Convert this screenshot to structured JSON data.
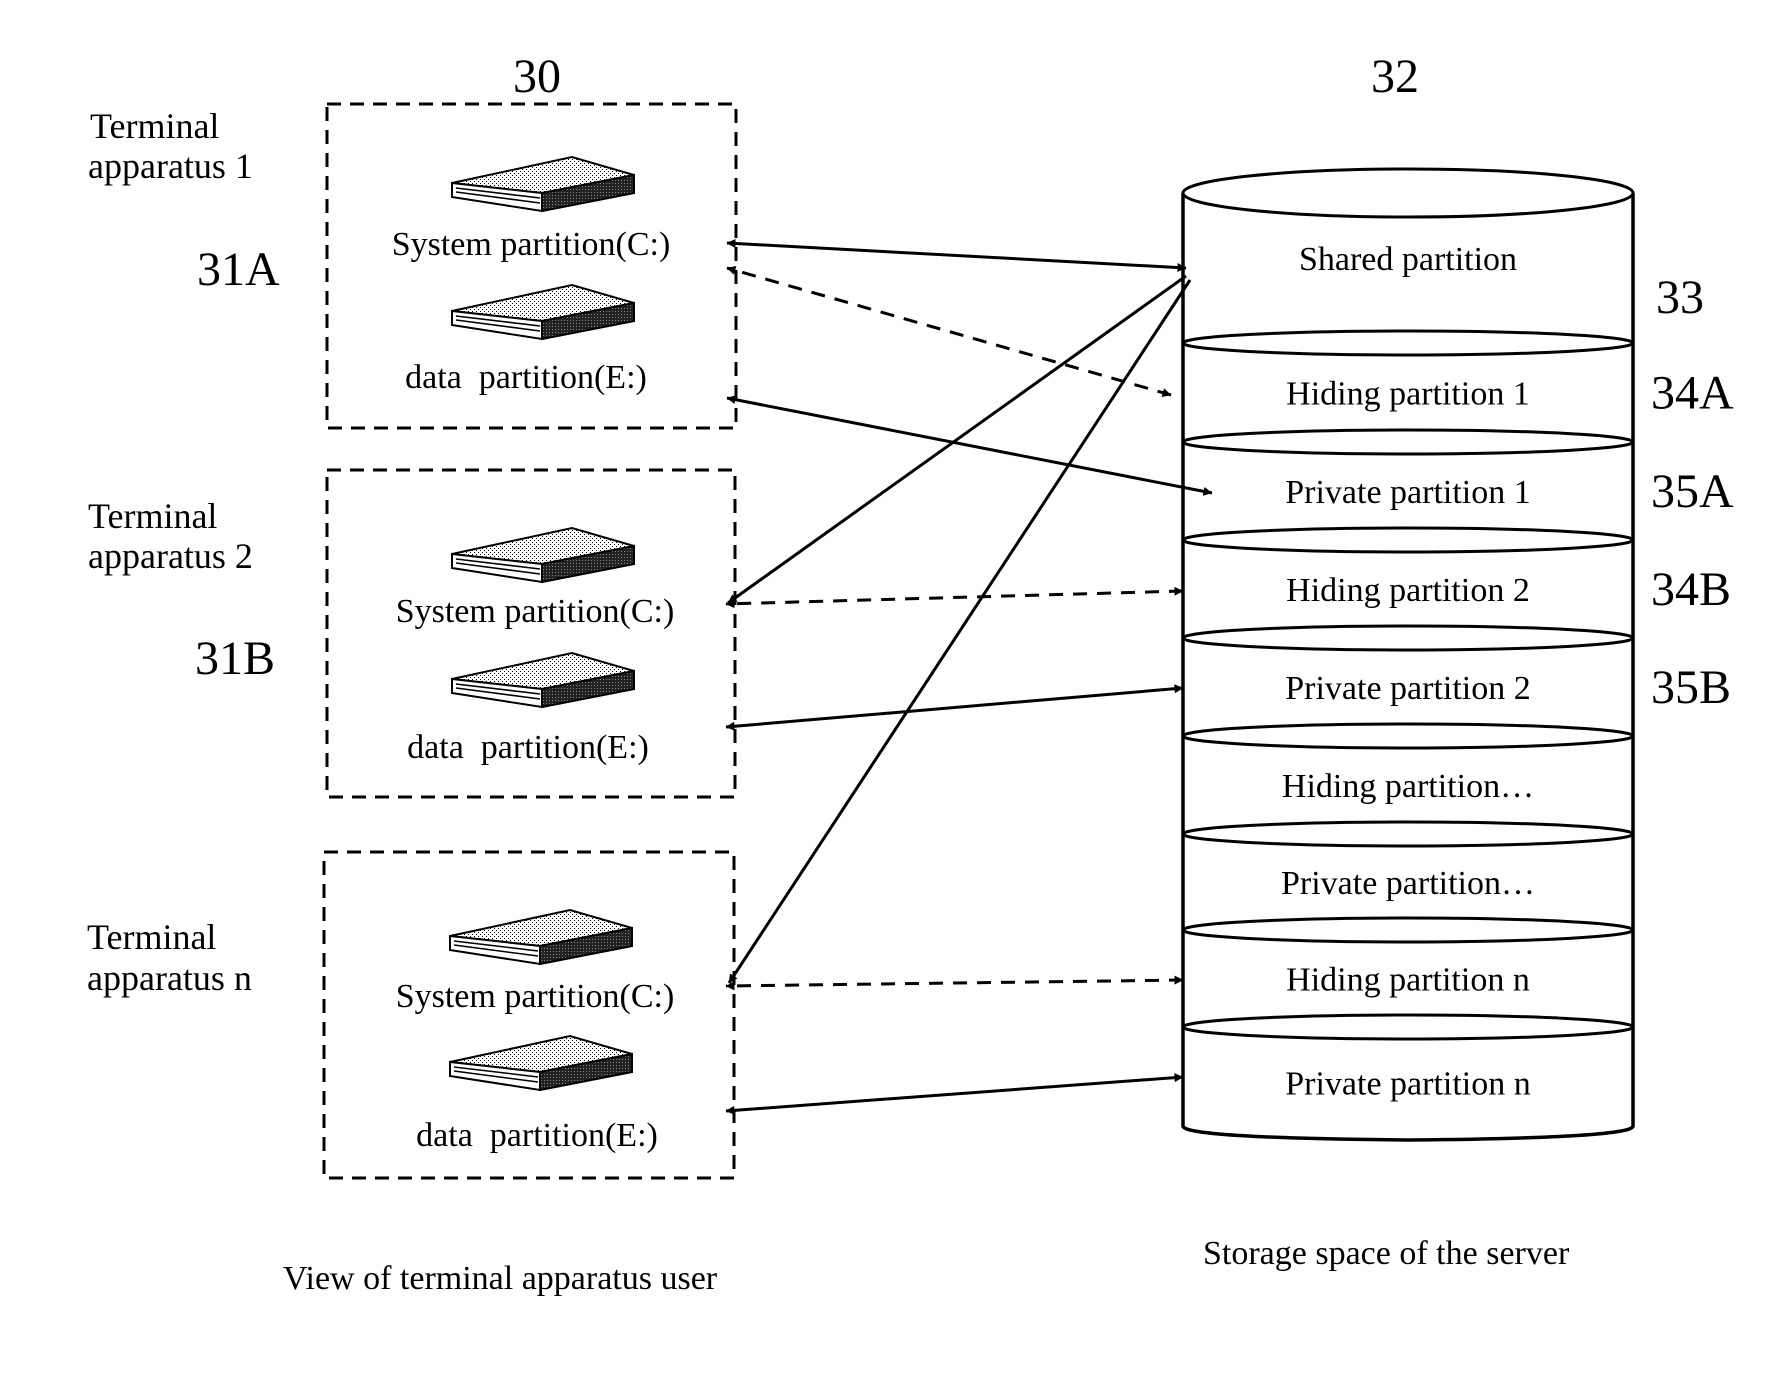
{
  "figure": {
    "ref_terminal_view": "30",
    "ref_server_storage": "32",
    "caption_left": "View of terminal apparatus user",
    "caption_right": "Storage space of the server"
  },
  "terminals": [
    {
      "name_line1": "Terminal",
      "name_line2": "apparatus 1",
      "ref": "31A",
      "system_partition": "System partition(C:)",
      "data_partition": "data  partition(E:)"
    },
    {
      "name_line1": "Terminal",
      "name_line2": "apparatus 2",
      "ref": "31B",
      "system_partition": "System partition(C:)",
      "data_partition": "data  partition(E:)"
    },
    {
      "name_line1": "Terminal",
      "name_line2": "apparatus n",
      "ref": "",
      "system_partition": "System partition(C:)",
      "data_partition": "data  partition(E:)"
    }
  ],
  "server": {
    "bands": [
      {
        "label": "Shared partition",
        "ref": "33"
      },
      {
        "label": "Hiding partition 1",
        "ref": "34A"
      },
      {
        "label": "Private partition 1",
        "ref": "35A"
      },
      {
        "label": "Hiding partition 2",
        "ref": "34B"
      },
      {
        "label": "Private partition 2",
        "ref": "35B"
      },
      {
        "label": "Hiding partition…",
        "ref": ""
      },
      {
        "label": "Private partition…",
        "ref": ""
      },
      {
        "label": "Hiding partition n",
        "ref": ""
      },
      {
        "label": "Private partition n",
        "ref": ""
      }
    ]
  },
  "connections": [
    {
      "from": "terminal-1-system",
      "to": "shared",
      "style": "solid"
    },
    {
      "from": "terminal-1-system",
      "to": "hiding-1",
      "style": "dashed"
    },
    {
      "from": "terminal-1-data",
      "to": "private-1",
      "style": "solid"
    },
    {
      "from": "terminal-2-system",
      "to": "shared",
      "style": "solid"
    },
    {
      "from": "terminal-2-system",
      "to": "hiding-2",
      "style": "dashed"
    },
    {
      "from": "terminal-2-data",
      "to": "private-2",
      "style": "solid"
    },
    {
      "from": "terminal-n-system",
      "to": "shared",
      "style": "solid"
    },
    {
      "from": "terminal-n-system",
      "to": "hiding-n",
      "style": "dashed"
    },
    {
      "from": "terminal-n-data",
      "to": "private-n",
      "style": "solid"
    }
  ]
}
